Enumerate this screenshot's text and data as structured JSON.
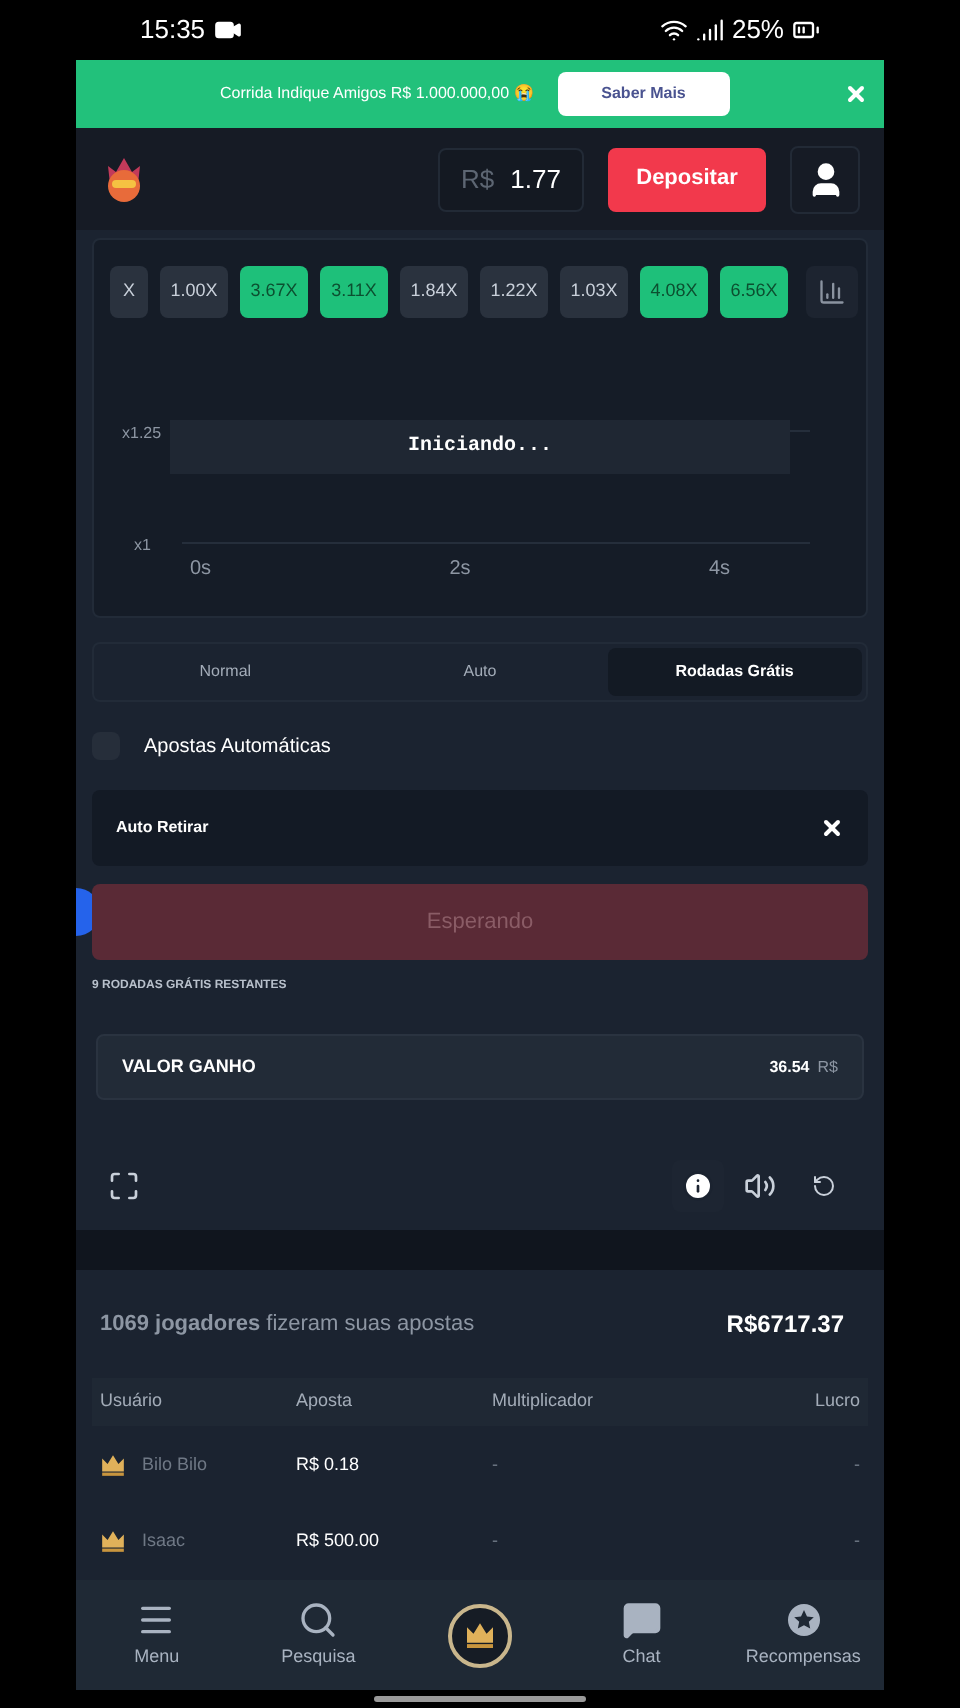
{
  "status_bar": {
    "time": "15:35",
    "battery": "25%"
  },
  "banner": {
    "text": "Corrida Indique Amigos R$ 1.000.000,00 😭",
    "button": "Saber Mais"
  },
  "header": {
    "currency": "R$",
    "balance": "1.77",
    "deposit": "Depositar"
  },
  "multipliers": [
    {
      "label": "X",
      "kind": "low"
    },
    {
      "label": "1.00X",
      "kind": "low"
    },
    {
      "label": "3.67X",
      "kind": "high"
    },
    {
      "label": "3.11X",
      "kind": "high"
    },
    {
      "label": "1.84X",
      "kind": "low"
    },
    {
      "label": "1.22X",
      "kind": "low"
    },
    {
      "label": "1.03X",
      "kind": "low"
    },
    {
      "label": "4.08X",
      "kind": "high"
    },
    {
      "label": "6.56X",
      "kind": "high"
    }
  ],
  "chart": {
    "status": "Iniciando...",
    "y_ticks": [
      "x1.25",
      "x1"
    ],
    "x_ticks": [
      "0s",
      "2s",
      "4s"
    ]
  },
  "tabs": [
    {
      "label": "Normal",
      "selected": false
    },
    {
      "label": "Auto",
      "selected": false
    },
    {
      "label": "Rodadas Grátis",
      "selected": true
    }
  ],
  "auto_bets": {
    "label": "Apostas Automáticas",
    "checked": false
  },
  "auto_cashout": {
    "label": "Auto Retirar"
  },
  "bet_button": {
    "label": "Esperando",
    "disabled": true
  },
  "free_rounds": "9 RODADAS GRÁTIS RESTANTES",
  "winnings": {
    "label": "VALOR GANHO",
    "value": "36.54",
    "currency": "R$"
  },
  "bets": {
    "summary": "**1069 jogadores** fizeram suas apostas",
    "total": "R$6717.37",
    "columns": [
      "Usuário",
      "Aposta",
      "Multiplicador",
      "Lucro"
    ],
    "rows": [
      {
        "user": "Bilo Bilo",
        "bet": "R$ 0.18",
        "multiplier": "-",
        "profit": "-"
      },
      {
        "user": "Isaac",
        "bet": "R$ 500.00",
        "multiplier": "-",
        "profit": "-"
      }
    ]
  },
  "nav": [
    {
      "label": "Menu",
      "kind": "menu"
    },
    {
      "label": "Pesquisa",
      "kind": "search"
    },
    {
      "kind": "home"
    },
    {
      "label": "Chat",
      "kind": "chat"
    },
    {
      "label": "Recompensas",
      "kind": "rewards"
    }
  ]
}
